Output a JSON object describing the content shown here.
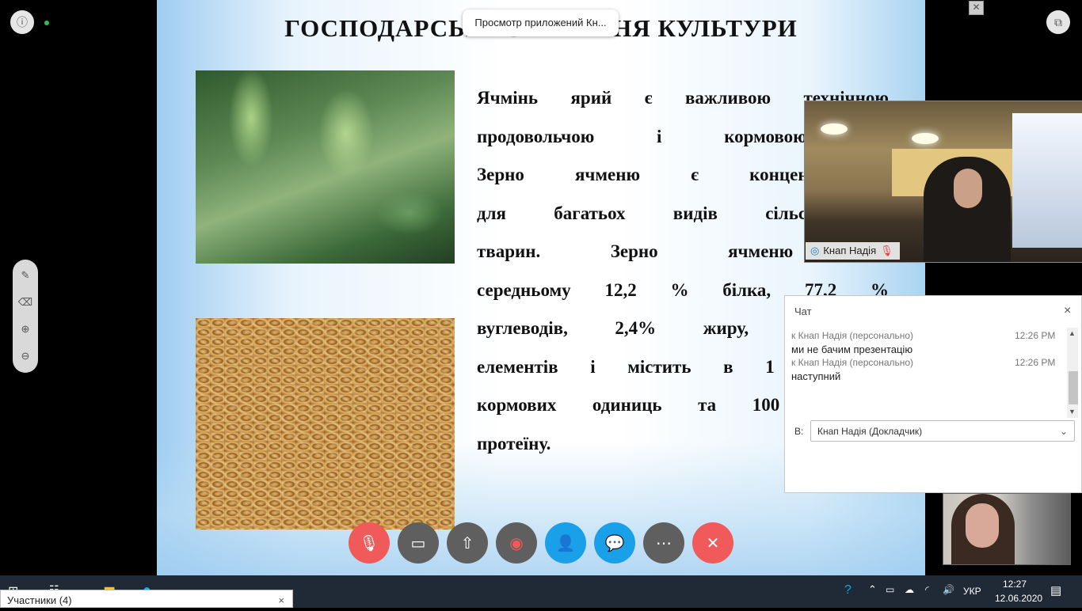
{
  "slide": {
    "title": "ГОСПОДАРСЬКЕ ЗНАЧЕННЯ КУЛЬТУРИ",
    "lines": [
      "Ячмінь ярий є важливою технічною",
      "продовольчою і кормовою ку",
      "Зерно ячменю є концентрованим",
      "для багатьох видів сільськогоспод",
      "тварин. Зерно ячменю міс",
      "середньому 12,2 % білка, 77,2 %",
      "вуглеводів, 2,4% жиру, до 3%",
      "елементів і містить в 1 кг при",
      "кормових одиниць та 100 г пер",
      "протеїну."
    ]
  },
  "toast": {
    "text": "Просмотр приложений Кн..."
  },
  "video_main": {
    "name": "Кнап Надія"
  },
  "chat": {
    "title": "Чат",
    "close": "×",
    "messages": [
      {
        "meta": "к Кнап Надія (персонально)",
        "time": "12:26 PM",
        "text": "ми не бачим презентацію"
      },
      {
        "meta": "к Кнап Надія (персонально)",
        "time": "12:26 PM",
        "text": "наступний"
      }
    ],
    "recipient_label": "В:",
    "recipient_value": "Кнап Надія (Докладчик)"
  },
  "controls": {
    "colors": {
      "mute": "#f05a5a",
      "grey": "#5f5f5f",
      "blue": "#1aa0e8",
      "end": "#f05a5a"
    }
  },
  "participants": {
    "label": "Участники (4)",
    "close": "×"
  },
  "taskbar": {
    "lang": "УКР",
    "time": "12:27",
    "date": "12.06.2020"
  }
}
